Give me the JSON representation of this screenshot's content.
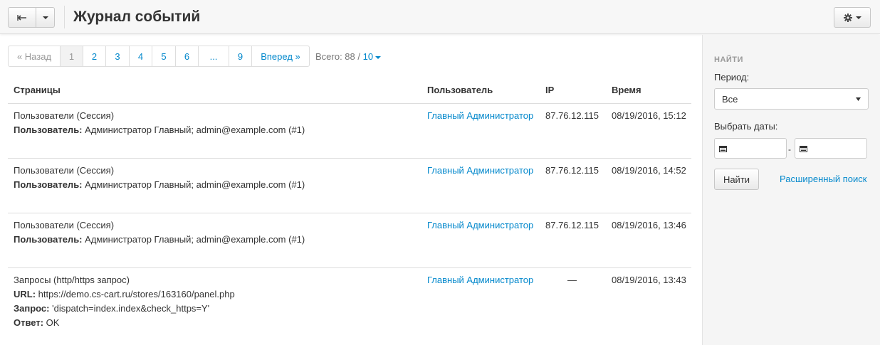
{
  "header": {
    "back_icon": "back-arrow-icon",
    "title": "Журнал событий",
    "tools_icon": "gear-icon"
  },
  "pagination": {
    "prev": "« Назад",
    "pages": [
      "1",
      "2",
      "3",
      "4",
      "5",
      "6",
      "...",
      "9"
    ],
    "active_page": "1",
    "next": "Вперед »",
    "total_label": "Всего: 88 /",
    "per_page": "10"
  },
  "table": {
    "columns": [
      "Страницы",
      "Пользователь",
      "IP",
      "Время"
    ],
    "rows": [
      {
        "page_lines": [
          {
            "label": "",
            "value": "Пользователи (Сессия)"
          },
          {
            "label": "Пользователь:",
            "value": " Администратор Главный; admin@example.com (#1)"
          }
        ],
        "user": "Главный Администратор",
        "ip": "87.76.12.115",
        "time": "08/19/2016, 15:12"
      },
      {
        "page_lines": [
          {
            "label": "",
            "value": "Пользователи (Сессия)"
          },
          {
            "label": "Пользователь:",
            "value": " Администратор Главный; admin@example.com (#1)"
          }
        ],
        "user": "Главный Администратор",
        "ip": "87.76.12.115",
        "time": "08/19/2016, 14:52"
      },
      {
        "page_lines": [
          {
            "label": "",
            "value": "Пользователи (Сессия)"
          },
          {
            "label": "Пользователь:",
            "value": " Администратор Главный; admin@example.com (#1)"
          }
        ],
        "user": "Главный Администратор",
        "ip": "87.76.12.115",
        "time": "08/19/2016, 13:46"
      },
      {
        "page_lines": [
          {
            "label": "",
            "value": "Запросы (http/https запрос)"
          },
          {
            "label": "URL:",
            "value": " https://demo.cs-cart.ru/stores/163160/panel.php"
          },
          {
            "label": "Запрос:",
            "value": " 'dispatch=index.index&check_https=Y'"
          },
          {
            "label": "Ответ:",
            "value": " OK"
          }
        ],
        "user": "Главный Администратор",
        "ip": "—",
        "time": "08/19/2016, 13:43"
      }
    ]
  },
  "sidebar": {
    "heading": "НАЙТИ",
    "period_label": "Период:",
    "period_value": "Все",
    "dates_label": "Выбрать даты:",
    "date_from": "",
    "date_to": "",
    "date_separator": "-",
    "calendar_icon": "calendar-icon",
    "find_button": "Найти",
    "advanced_search": "Расширенный поиск"
  },
  "colors": {
    "link": "#0388cc",
    "header_bg": "#f7f7f7",
    "sidebar_bg": "#f5f5f5"
  }
}
